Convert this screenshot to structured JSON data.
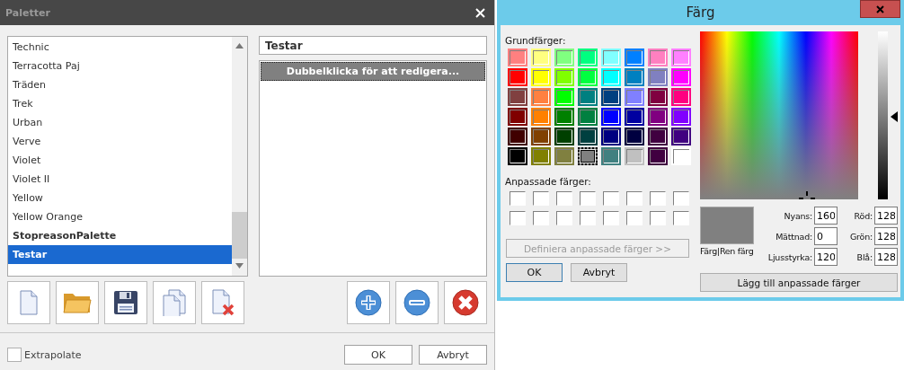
{
  "palettes_dialog": {
    "title": "Paletter",
    "palettes": [
      {
        "name": "Technic",
        "bold": false,
        "selected": false
      },
      {
        "name": "Terracotta Paj",
        "bold": false,
        "selected": false
      },
      {
        "name": "Träden",
        "bold": false,
        "selected": false
      },
      {
        "name": "Trek",
        "bold": false,
        "selected": false
      },
      {
        "name": "Urban",
        "bold": false,
        "selected": false
      },
      {
        "name": "Verve",
        "bold": false,
        "selected": false
      },
      {
        "name": "Violet",
        "bold": false,
        "selected": false
      },
      {
        "name": "Violet II",
        "bold": false,
        "selected": false
      },
      {
        "name": "Yellow",
        "bold": false,
        "selected": false
      },
      {
        "name": "Yellow Orange",
        "bold": false,
        "selected": false
      },
      {
        "name": "StopreasonPalette",
        "bold": true,
        "selected": false
      },
      {
        "name": "Testar",
        "bold": true,
        "selected": true
      }
    ],
    "name_field": {
      "value": "Testar"
    },
    "colors": [
      {
        "label": "Dubbelklicka för att redigera...",
        "color": "#808080",
        "selected": true
      }
    ],
    "extrapolate": {
      "label": "Extrapolate",
      "checked": false
    },
    "buttons": [
      "OK",
      "Avbryt"
    ]
  },
  "color_dialog": {
    "title": "Färg",
    "basic_label": "Grundfärger:",
    "basic_colors": [
      {
        "color": "#ff8080",
        "selected": false
      },
      {
        "color": "#ffff80",
        "selected": false
      },
      {
        "color": "#80ff80",
        "selected": false
      },
      {
        "color": "#00ff80",
        "selected": false
      },
      {
        "color": "#80ffff",
        "selected": false
      },
      {
        "color": "#0080ff",
        "selected": false
      },
      {
        "color": "#ff80c0",
        "selected": false
      },
      {
        "color": "#ff80ff",
        "selected": false
      },
      {
        "color": "#ff0000",
        "selected": false
      },
      {
        "color": "#ffff00",
        "selected": false
      },
      {
        "color": "#80ff00",
        "selected": false
      },
      {
        "color": "#00ff40",
        "selected": false
      },
      {
        "color": "#00ffff",
        "selected": false
      },
      {
        "color": "#0080c0",
        "selected": false
      },
      {
        "color": "#8080c0",
        "selected": false
      },
      {
        "color": "#ff00ff",
        "selected": false
      },
      {
        "color": "#804040",
        "selected": false
      },
      {
        "color": "#ff8040",
        "selected": false
      },
      {
        "color": "#00ff00",
        "selected": false
      },
      {
        "color": "#008080",
        "selected": false
      },
      {
        "color": "#004080",
        "selected": false
      },
      {
        "color": "#8080ff",
        "selected": false
      },
      {
        "color": "#800040",
        "selected": false
      },
      {
        "color": "#ff0080",
        "selected": false
      },
      {
        "color": "#800000",
        "selected": false
      },
      {
        "color": "#ff8000",
        "selected": false
      },
      {
        "color": "#008000",
        "selected": false
      },
      {
        "color": "#008040",
        "selected": false
      },
      {
        "color": "#0000ff",
        "selected": false
      },
      {
        "color": "#0000a0",
        "selected": false
      },
      {
        "color": "#800080",
        "selected": false
      },
      {
        "color": "#8000ff",
        "selected": false
      },
      {
        "color": "#400000",
        "selected": false
      },
      {
        "color": "#804000",
        "selected": false
      },
      {
        "color": "#004000",
        "selected": false
      },
      {
        "color": "#004040",
        "selected": false
      },
      {
        "color": "#000080",
        "selected": false
      },
      {
        "color": "#000040",
        "selected": false
      },
      {
        "color": "#400040",
        "selected": false
      },
      {
        "color": "#400080",
        "selected": false
      },
      {
        "color": "#000000",
        "selected": false
      },
      {
        "color": "#808000",
        "selected": false
      },
      {
        "color": "#808040",
        "selected": false
      },
      {
        "color": "#808080",
        "selected": true
      },
      {
        "color": "#408080",
        "selected": false
      },
      {
        "color": "#c0c0c0",
        "selected": false
      },
      {
        "color": "#400040",
        "selected": false
      },
      {
        "color": "#ffffff",
        "selected": false
      }
    ],
    "custom_label": "Anpassade färger:",
    "define_button": {
      "label": "Definiera anpassade färger >>",
      "disabled": true
    },
    "buttons": [
      "OK",
      "Avbryt"
    ],
    "preview_label": "Färg|Ren färg",
    "fields": [
      {
        "label": "Nyans:",
        "value": "160"
      },
      {
        "label": "Röd:",
        "value": "128"
      },
      {
        "label": "Mättnad:",
        "value": "0"
      },
      {
        "label": "Grön:",
        "value": "128"
      },
      {
        "label": "Ljusstyrka:",
        "value": "120"
      },
      {
        "label": "Blå:",
        "value": "128"
      }
    ],
    "add_button": "Lägg till anpassade färger"
  }
}
